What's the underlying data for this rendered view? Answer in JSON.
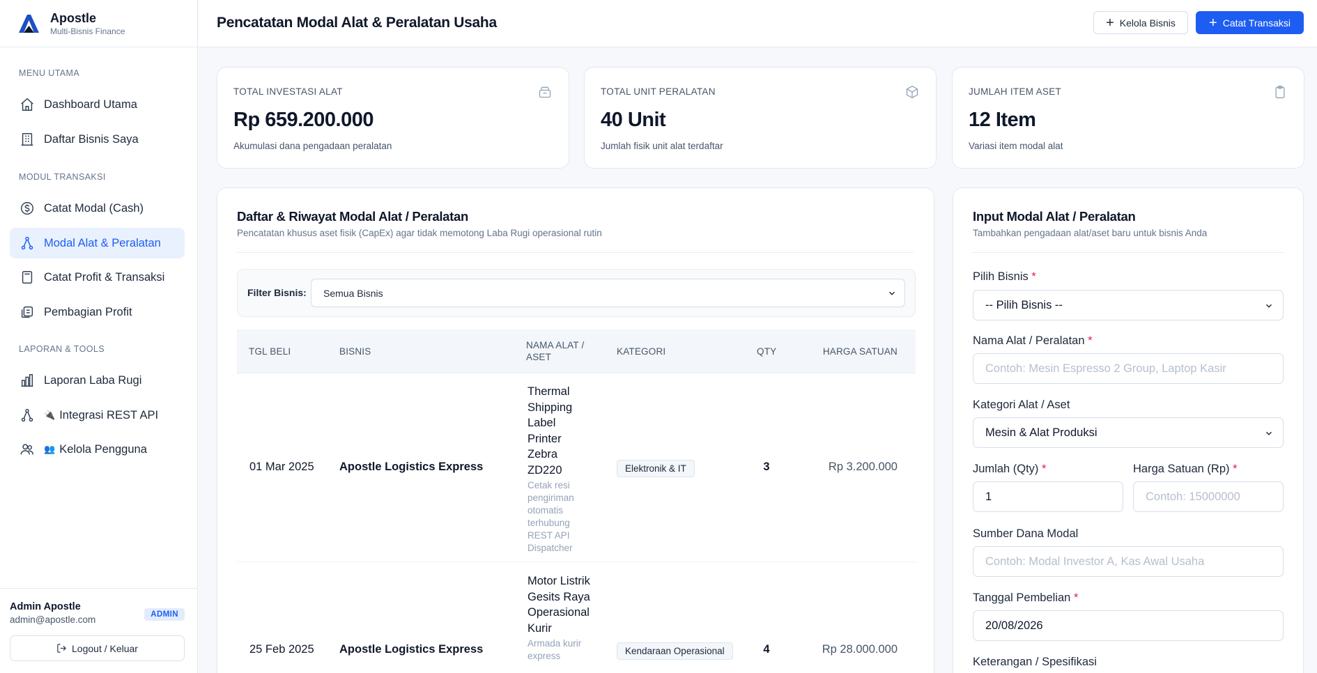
{
  "brand": {
    "name": "Apostle",
    "subtitle": "Multi-Bisnis Finance"
  },
  "nav": {
    "section_main": "MENU UTAMA",
    "section_transaksi": "MODUL TRANSAKSI",
    "section_laporan": "LAPORAN & TOOLS",
    "dashboard": "Dashboard Utama",
    "bisnis": "Daftar Bisnis Saya",
    "modal_cash": "Catat Modal (Cash)",
    "modal_alat": "Modal Alat & Peralatan",
    "profit": "Catat Profit & Transaksi",
    "pembagian": "Pembagian Profit",
    "laporan": "Laporan Laba Rugi",
    "api": "Integrasi REST API",
    "api_emoji": "🔌",
    "pengguna": "Kelola Pengguna",
    "pengguna_emoji": "👥"
  },
  "user": {
    "name": "Admin Apostle",
    "email": "admin@apostle.com",
    "role": "ADMIN",
    "logout": "Logout / Keluar"
  },
  "header": {
    "title": "Pencatatan Modal Alat & Peralatan Usaha",
    "btn_kelola": "Kelola Bisnis",
    "btn_catat": "Catat Transaksi"
  },
  "stats": [
    {
      "label": "TOTAL INVESTASI ALAT",
      "value": "Rp 659.200.000",
      "desc": "Akumulasi dana pengadaan peralatan"
    },
    {
      "label": "TOTAL UNIT PERALATAN",
      "value": "40 Unit",
      "desc": "Jumlah fisik unit alat terdaftar"
    },
    {
      "label": "JUMLAH ITEM ASET",
      "value": "12 Item",
      "desc": "Variasi item modal alat"
    }
  ],
  "list": {
    "title": "Daftar & Riwayat Modal Alat / Peralatan",
    "subtitle": "Pencatatan khusus aset fisik (CapEx) agar tidak memotong Laba Rugi operasional rutin",
    "filter_label": "Filter Bisnis:",
    "filter_value": "Semua Bisnis",
    "columns": {
      "tgl": "TGL BELI",
      "bisnis": "BISNIS",
      "nama": "NAMA ALAT / ASET",
      "kategori": "KATEGORI",
      "qty": "QTY",
      "harga": "HARGA SATUAN"
    },
    "rows": [
      {
        "tgl": "01 Mar 2025",
        "bisnis": "Apostle Logistics Express",
        "nama": "Thermal Shipping Label Printer Zebra ZD220",
        "desc": "Cetak resi pengiriman otomatis terhubung REST API Dispatcher",
        "kategori": "Elektronik & IT",
        "qty": "3",
        "harga": "Rp 3.200.000"
      },
      {
        "tgl": "25 Feb 2025",
        "bisnis": "Apostle Logistics Express",
        "nama": "Motor Listrik Gesits Raya Operasional Kurir",
        "desc": "Armada kurir express",
        "kategori": "Kendaraan Operasional",
        "qty": "4",
        "harga": "Rp 28.000.000"
      }
    ]
  },
  "form": {
    "title": "Input Modal Alat / Peralatan",
    "subtitle": "Tambahkan pengadaan alat/aset baru untuk bisnis Anda",
    "bisnis_label": "Pilih Bisnis",
    "bisnis_value": "-- Pilih Bisnis --",
    "nama_label": "Nama Alat / Peralatan",
    "nama_placeholder": "Contoh: Mesin Espresso 2 Group, Laptop Kasir",
    "kategori_label": "Kategori Alat / Aset",
    "kategori_value": "Mesin & Alat Produksi",
    "qty_label": "Jumlah (Qty)",
    "qty_value": "1",
    "harga_label": "Harga Satuan (Rp)",
    "harga_placeholder": "Contoh: 15000000",
    "sumber_label": "Sumber Dana Modal",
    "sumber_placeholder": "Contoh: Modal Investor A, Kas Awal Usaha",
    "tanggal_label": "Tanggal Pembelian",
    "tanggal_value": "20/08/2026",
    "keterangan_label": "Keterangan / Spesifikasi",
    "required_mark": "*"
  },
  "colors": {
    "accent": "#1e5df2",
    "active_bg": "#e9f1fe",
    "required": "#e11d48"
  }
}
